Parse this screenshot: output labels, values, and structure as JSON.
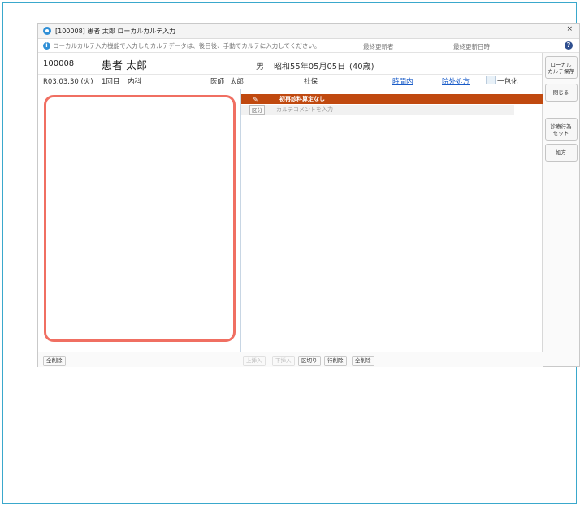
{
  "window": {
    "title": "[100008] 患者 太郎 ローカルカルテ入力",
    "close_label": "×"
  },
  "notice": {
    "text": "ローカルカルテ入力機能で入力したカルテデータは、後日後、手動でカルテに入力してください。",
    "last_updater_label": "最終更新者",
    "last_updated_label": "最終更新日時",
    "help_label": "?"
  },
  "patient": {
    "id": "100008",
    "name": "患者 太郎",
    "sex": "男",
    "birth": "昭和55年05月05日",
    "age": "(40歳)"
  },
  "visit": {
    "date": "R03.03.30 (火)",
    "count": "1回目",
    "dept": "内科",
    "doctor_label": "医師",
    "doctor": "太郎",
    "insurance": "社保",
    "link_time": "時間内",
    "link_outside": "院外処方",
    "checkbox_label": "一包化"
  },
  "entry": {
    "orange_label": "初再診料算定なし",
    "kubun_label": "区分",
    "comment_placeholder": "カルテコメントを入力"
  },
  "side_buttons": {
    "save": "ローカル\nカルテ保存",
    "close": "閉じる",
    "medical": "診療行為\nセット",
    "rx": "処方"
  },
  "bottom": {
    "left_delete": "全削除",
    "btn1": "上挿入",
    "btn2": "下挿入",
    "btn3": "区切り",
    "btn4": "行削除",
    "btn5": "全削除"
  }
}
